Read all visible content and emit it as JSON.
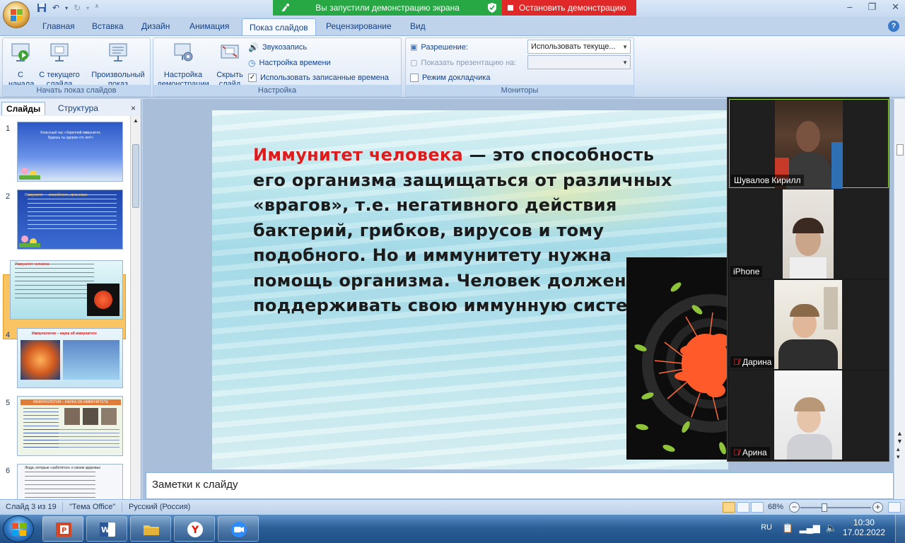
{
  "share": {
    "sharing_text": "Вы запустили демонстрацию экрана",
    "stop_label": "Остановить демонстрацию",
    "green": "#28a745",
    "red": "#e02828"
  },
  "tabs": [
    "Главная",
    "Вставка",
    "Дизайн",
    "Анимация",
    "Показ слайдов",
    "Рецензирование",
    "Вид"
  ],
  "active_tab": "Показ слайдов",
  "ribbon": {
    "start_group": {
      "label": "Начать показ слайдов",
      "from_start": "С начала",
      "from_current": "С текущего слайда",
      "custom_show": "Произвольный показ"
    },
    "setup_group": {
      "label": "Настройка",
      "setup_show": "Настройка демонстрации",
      "hide_slide": "Скрыть слайд",
      "record_narration": "Звукозапись",
      "rehearse_timings": "Настройка времени",
      "use_timings": "Использовать записанные времена"
    },
    "monitors_group": {
      "label": "Мониторы",
      "resolution_label": "Разрешение:",
      "resolution_value": "Использовать текуще...",
      "show_on_label": "Показать презентацию на:",
      "presenter_view": "Режим докладчика"
    }
  },
  "left_pane": {
    "tab_slides": "Слайды",
    "tab_outline": "Структура",
    "close_icon": "×",
    "slides": [
      {
        "num": "1",
        "title": "Классный час «Укрепляй иммунитет, будешь ты здоров сто лет!»"
      },
      {
        "num": "2",
        "title": "Иммунитет — способность организма"
      },
      {
        "num": "3",
        "title": "Иммунитет человека"
      },
      {
        "num": "4",
        "title": "Иммунология – наука об иммунитете"
      },
      {
        "num": "5",
        "title": "ИММУНОЛОГИЯ – НАУКА ОБ ИММУНИТЕТЕ"
      },
      {
        "num": "6",
        "title": "Люди, которые «заботятся» о своем здоровье"
      }
    ],
    "selected_index": 3
  },
  "slide": {
    "highlight": "Иммунитет человека",
    "body": " — это способность его организма защищаться от различных «врагов», т.е.    негативного действия бактерий, грибков, вирусов и тому подобного. Но и иммунитету нужна помощь организма. Человек должен поддерживать  свою иммунную систему."
  },
  "participants": [
    {
      "name": "Шувалов Кирилл",
      "muted": false,
      "active": true
    },
    {
      "name": "iPhone",
      "muted": false,
      "active": false
    },
    {
      "name": "Дарина",
      "muted": true,
      "active": false
    },
    {
      "name": "Арина",
      "muted": true,
      "active": false
    }
  ],
  "notes_placeholder": "Заметки к слайду",
  "status": {
    "slide_counter": "Слайд 3 из 19",
    "theme": "\"Тема Office\"",
    "language": "Русский (Россия)",
    "zoom": "68%",
    "zoom_level": 0.68
  },
  "taskbar": {
    "language": "RU",
    "time": "10:30",
    "date": "17.02.2022",
    "apps": [
      "powerpoint-icon",
      "word-icon",
      "explorer-icon",
      "yandex-icon",
      "zoom-icon"
    ]
  }
}
